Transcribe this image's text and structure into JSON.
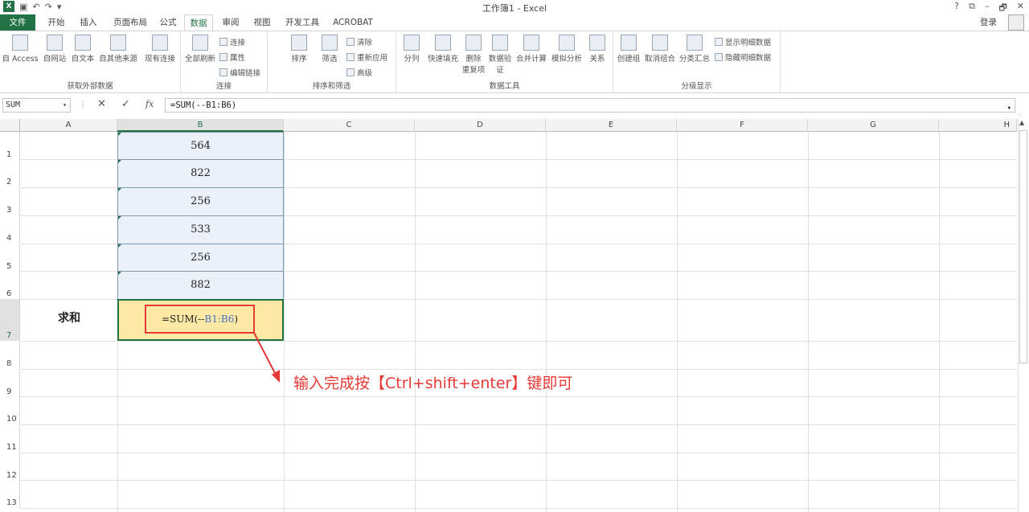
{
  "window": {
    "title": "工作簿1 - Excel",
    "help": "?",
    "restore": "⧉",
    "minimize": "–",
    "maximize": "🗗",
    "close": "✕"
  },
  "qat": {
    "logo": "X",
    "save_icon": "save-icon",
    "undo": "↶",
    "redo": "↷"
  },
  "tabs": [
    "文件",
    "开始",
    "插入",
    "页面布局",
    "公式",
    "数据",
    "审阅",
    "视图",
    "开发工具",
    "ACROBAT"
  ],
  "active_tab": "数据",
  "login": "登录",
  "ribbon": {
    "groups": [
      {
        "label": "获取外部数据",
        "buttons": [
          "自 Access",
          "自网站",
          "自文本",
          "自其他来源",
          "现有连接"
        ]
      },
      {
        "label": "连接",
        "buttons": [
          "全部刷新"
        ],
        "small": [
          "连接",
          "属性",
          "编辑链接"
        ]
      },
      {
        "label": "排序和筛选",
        "buttons": [
          "排序",
          "筛选"
        ],
        "small": [
          "清除",
          "重新应用",
          "高级"
        ]
      },
      {
        "label": "数据工具",
        "buttons": [
          "分列",
          "快速填充",
          "删除\n重复项",
          "数据验\n证",
          "合并计算",
          "模拟分析",
          "关系"
        ]
      },
      {
        "label": "分级显示",
        "buttons": [
          "创建组",
          "取消组合",
          "分类汇总"
        ],
        "small": [
          "显示明细数据",
          "隐藏明细数据"
        ]
      }
    ]
  },
  "formula_bar": {
    "name_box": "SUM",
    "cancel": "✕",
    "enter": "✓",
    "fx": "fx",
    "formula": "=SUM(--B1:B6)"
  },
  "columns": [
    "A",
    "B",
    "C",
    "D",
    "E",
    "F",
    "G",
    "H"
  ],
  "rows": [
    "1",
    "2",
    "3",
    "4",
    "5",
    "6",
    "7",
    "8",
    "9",
    "10",
    "11",
    "12",
    "13"
  ],
  "cells": {
    "B": [
      "564",
      "822",
      "256",
      "533",
      "256",
      "882"
    ],
    "A7": "求和",
    "B7_prefix": "=SUM(--",
    "B7_ref": "B1:B6",
    "B7_suffix": ")"
  },
  "annotation": "输入完成按【Ctrl+shift+enter】键即可",
  "colors": {
    "accent": "#217346",
    "highlight": "#fde8a5",
    "annotation": "#e53935"
  }
}
